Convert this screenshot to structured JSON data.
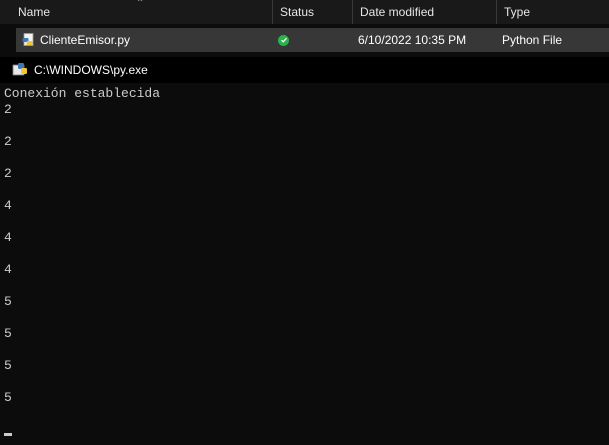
{
  "explorer": {
    "columns": {
      "name": "Name",
      "status": "Status",
      "date_modified": "Date modified",
      "type": "Type"
    },
    "file": {
      "name": "ClienteEmisor.py",
      "status_icon": "synced-check-icon",
      "date_modified": "6/10/2022 10:35 PM",
      "type": "Python File"
    }
  },
  "console": {
    "title": "C:\\WINDOWS\\py.exe",
    "lines": [
      "Conexión establecida",
      "2",
      "2",
      "2",
      "4",
      "4",
      "4",
      "5",
      "5",
      "5",
      "5"
    ]
  },
  "colors": {
    "status_ok": "#2bb24c",
    "console_bg": "#0c0c0c",
    "console_text": "#cccccc"
  }
}
